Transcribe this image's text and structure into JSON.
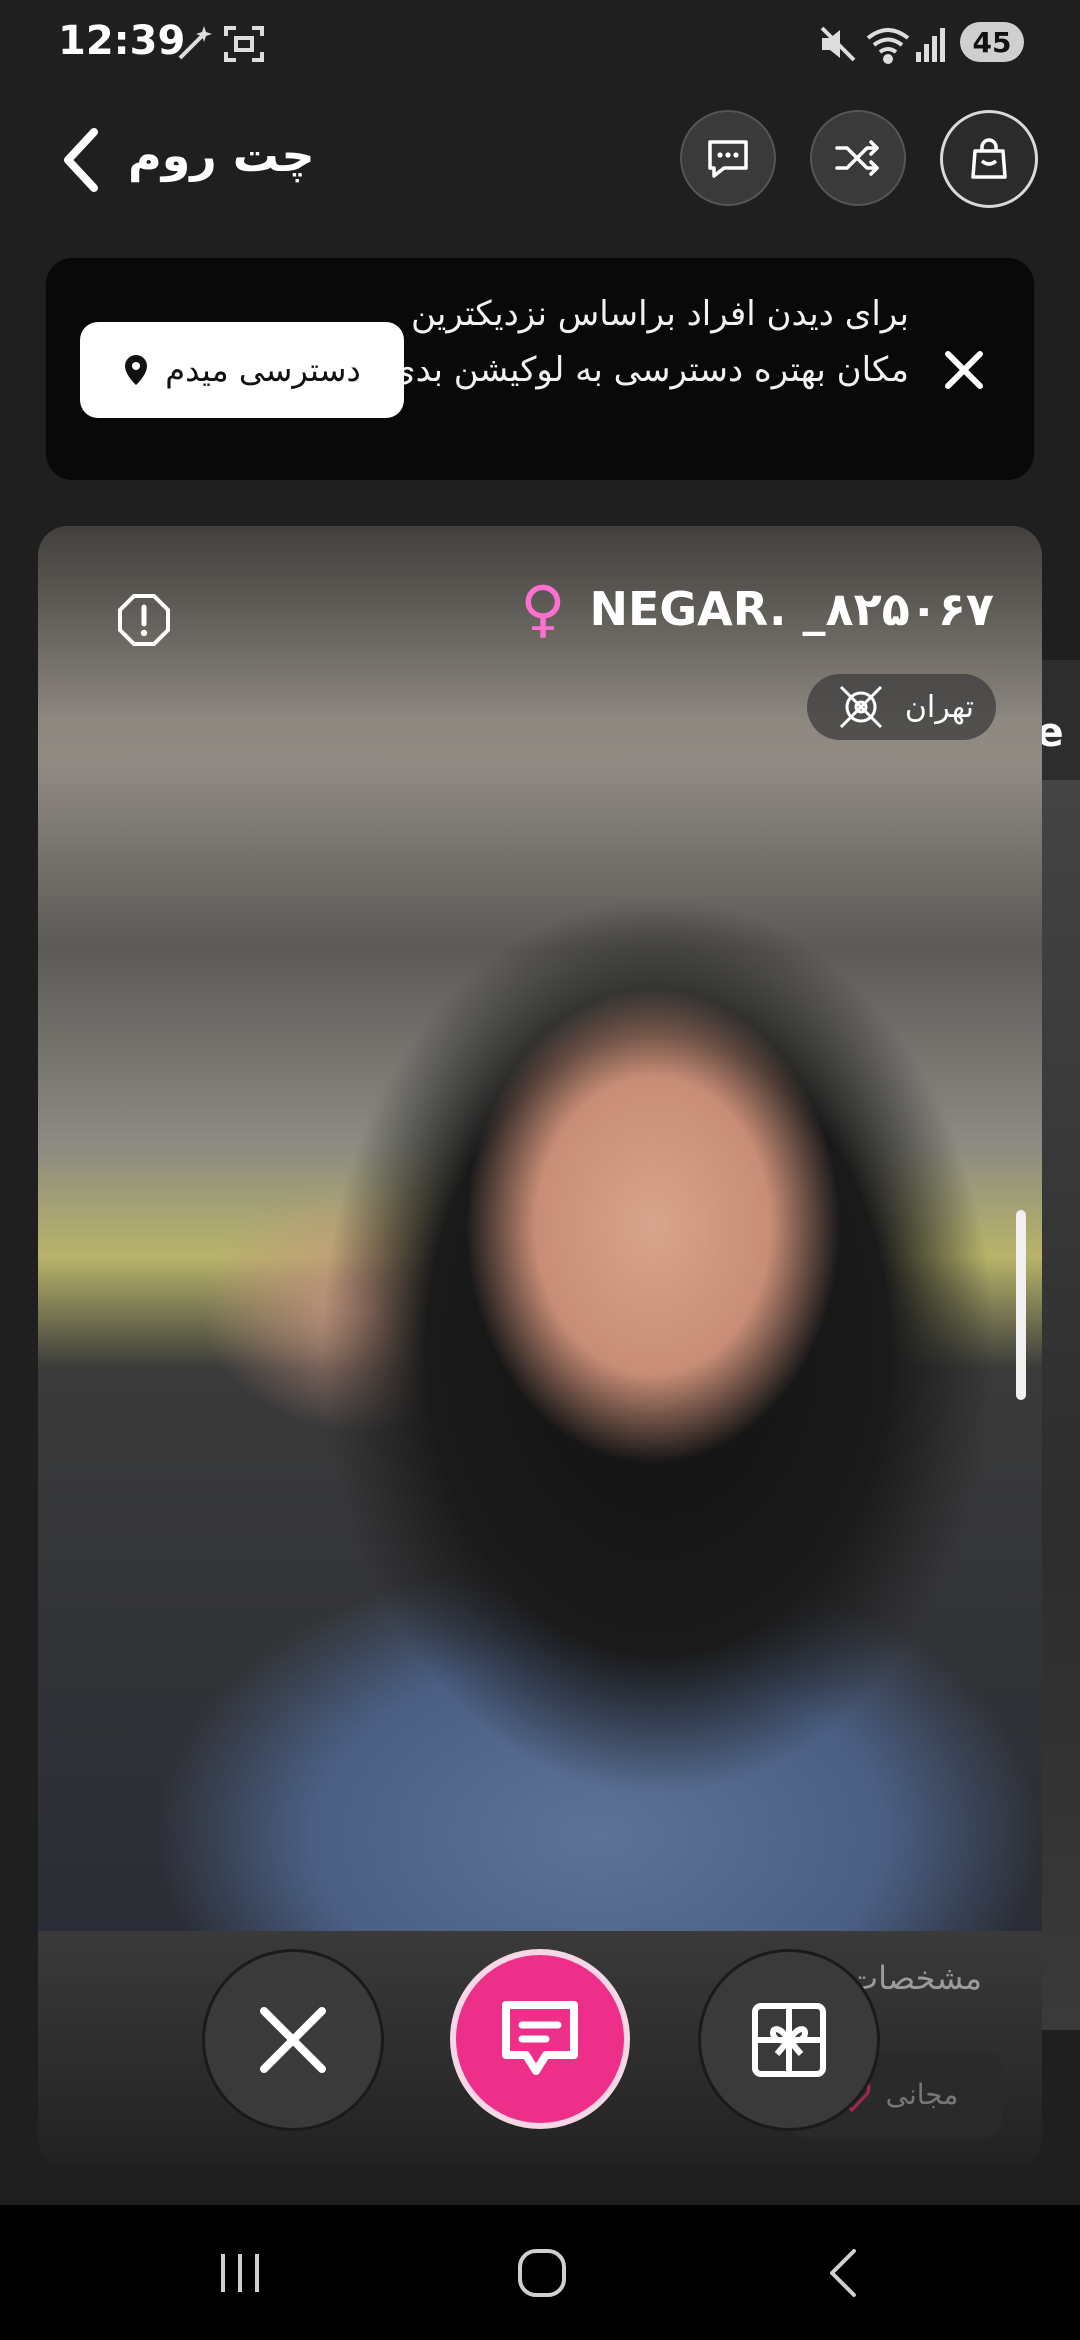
{
  "status_bar": {
    "time": "12:39",
    "battery": "45",
    "icons": [
      "magic-wand-icon",
      "screen-capture-icon",
      "mute-icon",
      "wifi-icon",
      "signal-icon",
      "battery-icon"
    ]
  },
  "header": {
    "title": "چت روم",
    "buttons": [
      "chat-bubble-icon",
      "shuffle-icon",
      "shopping-bag-icon"
    ]
  },
  "location_banner": {
    "message": "برای دیدن افراد براساس نزدیکترین مکان بهتره دسترسی به لوکیشن بدی",
    "grant_button": "دسترسی میدم"
  },
  "profile": {
    "username": "NEGAR. _۸۲۵۰۶۷",
    "gender_symbol": "♀",
    "city": "تهران",
    "details_label": "مشخصات",
    "free_chip_label": "مجانی"
  },
  "next_card": {
    "username_fragment": "ne"
  },
  "colors": {
    "accent_pink": "#ee2f8a",
    "female_icon": "#ff6fd0",
    "background": "#1f1f1f"
  }
}
